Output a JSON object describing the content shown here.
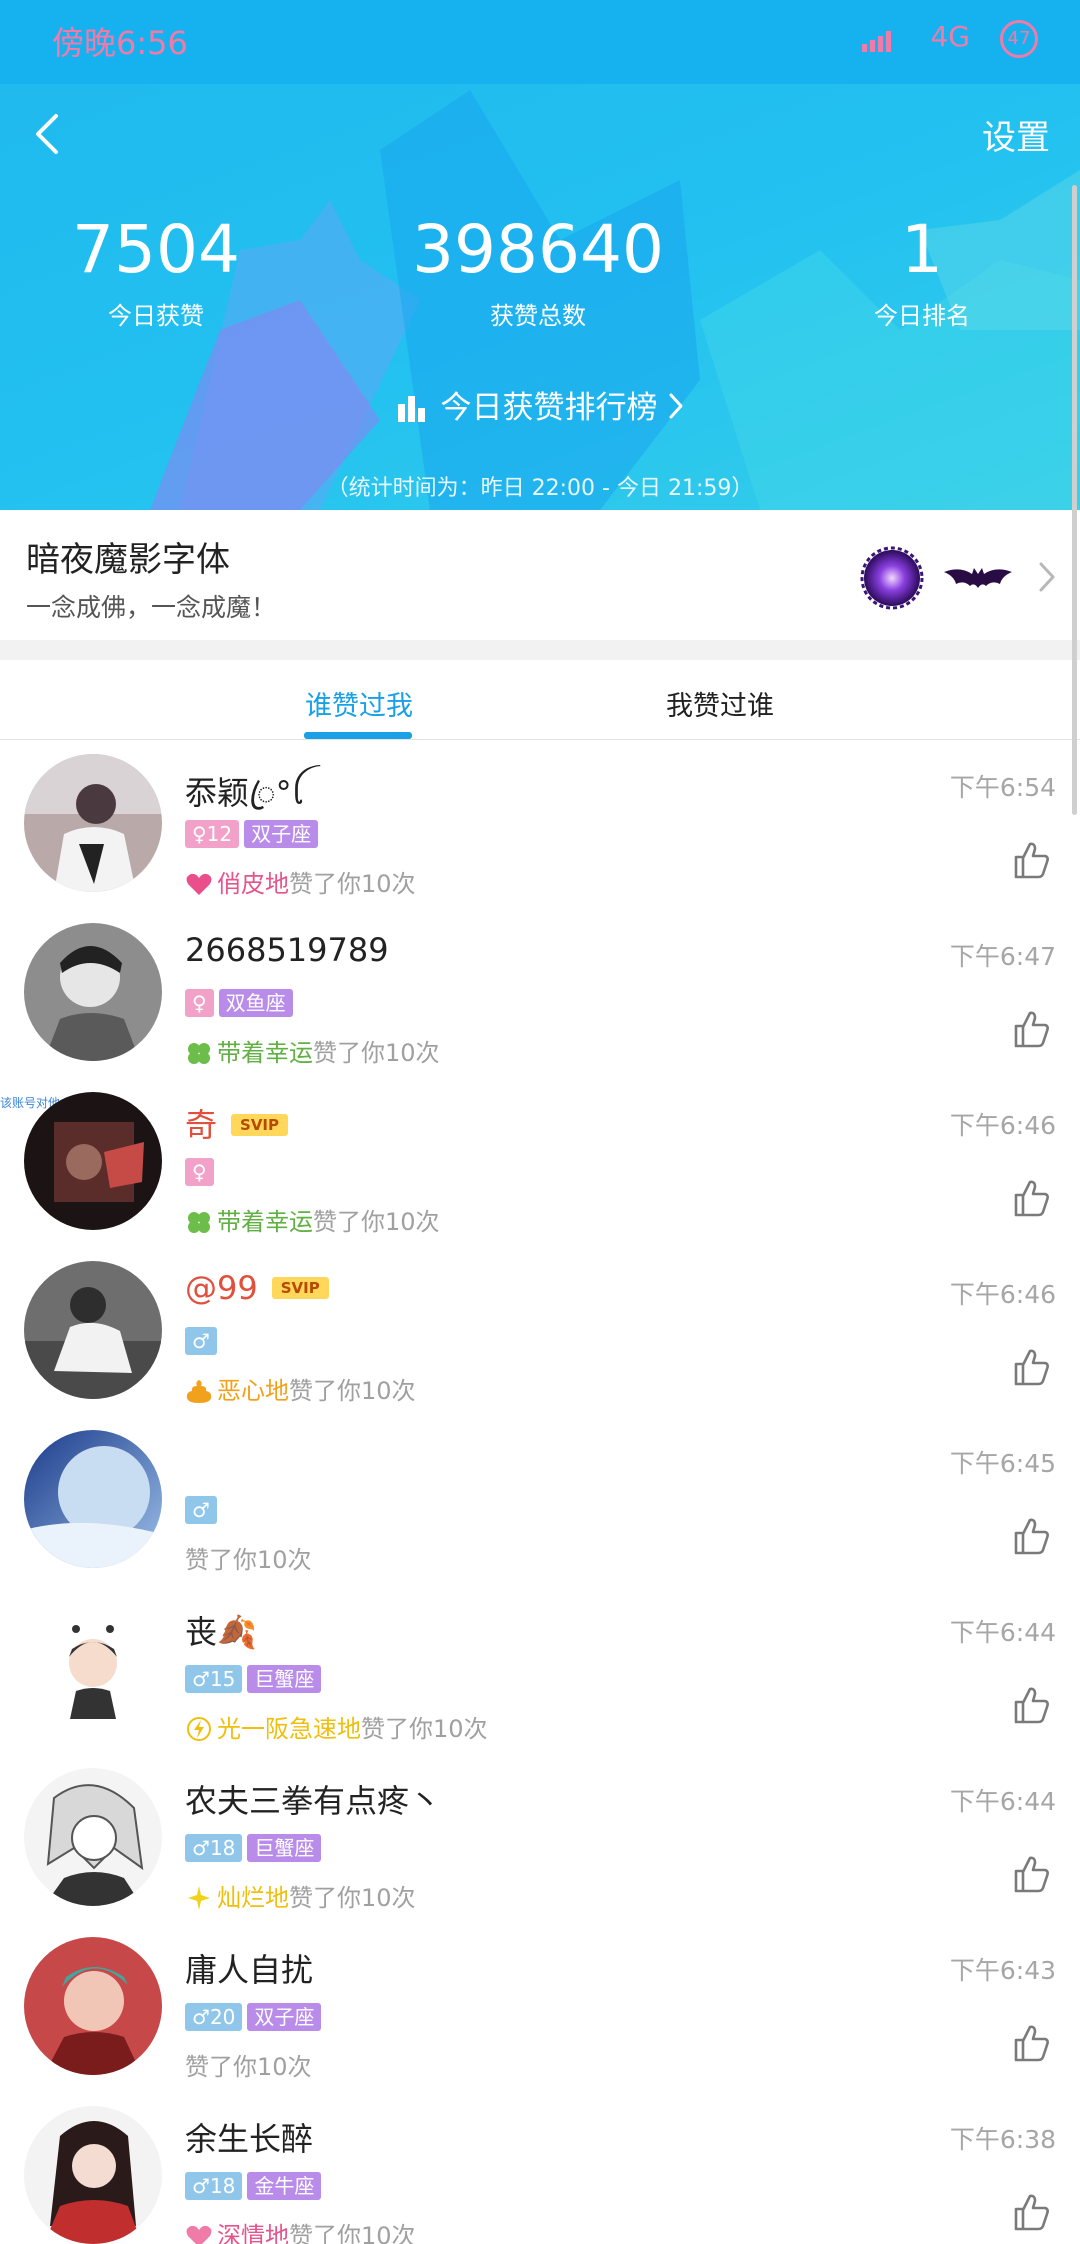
{
  "status": {
    "time": "傍晚6:56",
    "network": "4G",
    "battery": "47"
  },
  "header": {
    "settings_label": "设置",
    "stats": [
      {
        "value": "7504",
        "label": "今日获赞"
      },
      {
        "value": "398640",
        "label": "获赞总数"
      },
      {
        "value": "1",
        "label": "今日排名"
      }
    ],
    "rank_link": "今日获赞排行榜",
    "stat_period": "（统计时间为：昨日 22:00 - 今日 21:59）"
  },
  "banner": {
    "title": "暗夜魔影字体",
    "subtitle": "一念成佛，一念成魔！"
  },
  "tabs": [
    {
      "label": "谁赞过我",
      "active": true
    },
    {
      "label": "我赞过谁",
      "active": false
    }
  ],
  "side_mark": "该账号对他",
  "list": [
    {
      "nick": "忝颖ꦿ°ꪶ",
      "svip": "",
      "gender": "♀",
      "age": "12",
      "zodiac": "双子座",
      "effect": "俏皮地",
      "effect_icon": "heart-icon",
      "suffix": "赞了你10次",
      "time": "下午6:54"
    },
    {
      "nick": "2668519789",
      "svip": "",
      "gender": "♀",
      "age": "",
      "zodiac": "双鱼座",
      "effect": "带着幸运",
      "effect_icon": "clover-icon",
      "suffix": "赞了你10次",
      "time": "下午6:47"
    },
    {
      "nick": "奇",
      "svip": "SVIP",
      "gender": "♀",
      "age": "",
      "zodiac": "",
      "effect": "带着幸运",
      "effect_icon": "clover-icon",
      "suffix": "赞了你10次",
      "time": "下午6:46"
    },
    {
      "nick": "@99",
      "svip": "SVIP",
      "gender": "♂",
      "age": "",
      "zodiac": "",
      "effect": "恶心地",
      "effect_icon": "poop-icon",
      "suffix": "赞了你10次",
      "time": "下午6:46"
    },
    {
      "nick": "",
      "svip": "",
      "gender": "♂",
      "age": "",
      "zodiac": "",
      "effect": "",
      "effect_icon": "",
      "suffix": "赞了你10次",
      "time": "下午6:45"
    },
    {
      "nick": "丧🍂",
      "svip": "",
      "gender": "♂",
      "age": "15",
      "zodiac": "巨蟹座",
      "effect": "光一阪急速地",
      "effect_icon": "lightning-icon",
      "suffix": "赞了你10次",
      "time": "下午6:44"
    },
    {
      "nick": "农夫三拳有点疼丶",
      "svip": "",
      "gender": "♂",
      "age": "18",
      "zodiac": "巨蟹座",
      "effect": "灿烂地",
      "effect_icon": "sparkle-icon",
      "suffix": "赞了你10次",
      "time": "下午6:44"
    },
    {
      "nick": "庸人自扰",
      "svip": "",
      "gender": "♂",
      "age": "20",
      "zodiac": "双子座",
      "effect": "",
      "effect_icon": "",
      "suffix": "赞了你10次",
      "time": "下午6:43"
    },
    {
      "nick": "余生长醉",
      "svip": "",
      "gender": "♂",
      "age": "18",
      "zodiac": "金牛座",
      "effect": "深情地",
      "effect_icon": "heart-icon",
      "suffix": "赞了你10次",
      "time": "下午6:38"
    }
  ]
}
